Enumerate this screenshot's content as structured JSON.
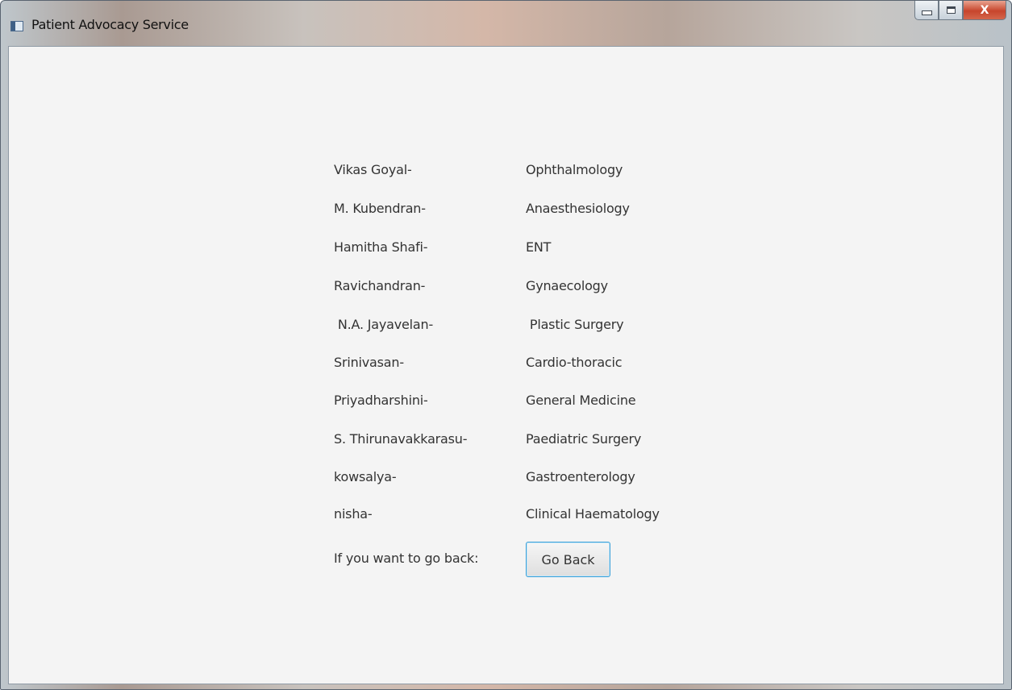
{
  "window": {
    "title": "Patient Advocacy Service"
  },
  "doctors": [
    {
      "name": "Vikas Goyal-",
      "department": "Ophthalmology"
    },
    {
      "name": "M. Kubendran-",
      "department": "Anaesthesiology"
    },
    {
      "name": "Hamitha Shafi-",
      "department": "ENT"
    },
    {
      "name": "Ravichandran-",
      "department": "Gynaecology"
    },
    {
      "name": " N.A. Jayavelan-",
      "department": " Plastic Surgery"
    },
    {
      "name": "Srinivasan-",
      "department": "Cardio-thoracic"
    },
    {
      "name": "Priyadharshini-",
      "department": "General Medicine"
    },
    {
      "name": "S. Thirunavakkarasu-",
      "department": "Paediatric Surgery"
    },
    {
      "name": "kowsalya-",
      "department": "Gastroenterology"
    },
    {
      "name": "nisha-",
      "department": "Clinical Haematology"
    }
  ],
  "back": {
    "label": "If you want to go back:",
    "button_label": "Go Back"
  },
  "caption_buttons": {
    "close_glyph": "X"
  },
  "colors": {
    "accent_focus": "#3aa0d8",
    "close_red": "#c7452c"
  }
}
